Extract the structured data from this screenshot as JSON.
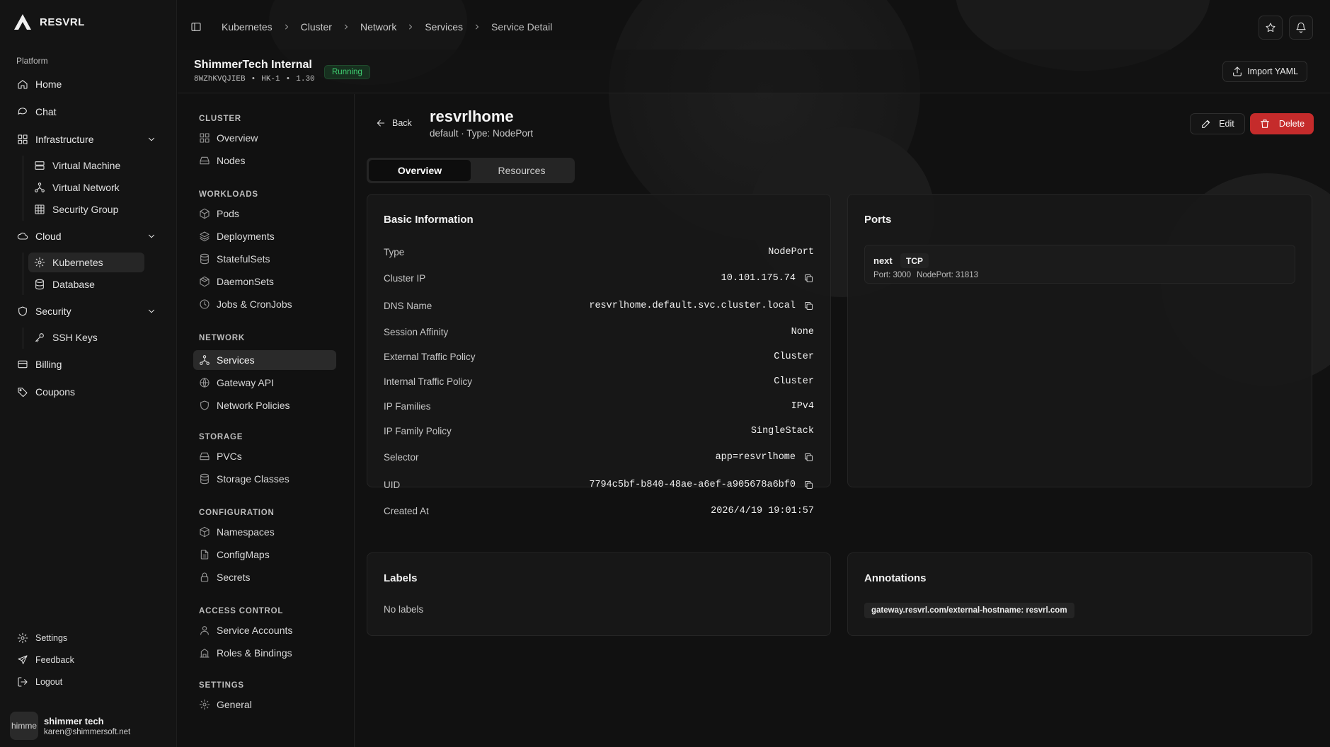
{
  "brand": {
    "name": "RESVRL"
  },
  "sidebar": {
    "group_label": "Platform",
    "items": [
      {
        "label": "Home",
        "icon": "home-icon"
      },
      {
        "label": "Chat",
        "icon": "chat-icon"
      },
      {
        "label": "Infrastructure",
        "icon": "grid-icon",
        "sub": [
          "Virtual Machine",
          "Virtual Network",
          "Security Group"
        ]
      },
      {
        "label": "Cloud",
        "icon": "cloud-icon",
        "sub": [
          "Kubernetes",
          "Database"
        ]
      },
      {
        "label": "Security",
        "icon": "shield-icon",
        "sub": [
          "SSH Keys"
        ]
      },
      {
        "label": "Billing",
        "icon": "card-icon"
      },
      {
        "label": "Coupons",
        "icon": "tag-icon"
      }
    ],
    "footer": [
      "Settings",
      "Feedback",
      "Logout"
    ],
    "user": {
      "avatar_text": "himme",
      "name": "shimmer tech",
      "email": "karen@shimmersoft.net"
    }
  },
  "breadcrumbs": [
    "Kubernetes",
    "Cluster",
    "Network",
    "Services",
    "Service Detail"
  ],
  "cluster": {
    "name": "ShimmerTech Internal",
    "id": "8WZhKVQJIEB",
    "region": "HK-1",
    "version": "1.30",
    "status": "Running",
    "dot": "•",
    "import_label": "Import YAML"
  },
  "subnav": {
    "sections": [
      {
        "title": "CLUSTER",
        "items": [
          "Overview",
          "Nodes"
        ]
      },
      {
        "title": "WORKLOADS",
        "items": [
          "Pods",
          "Deployments",
          "StatefulSets",
          "DaemonSets",
          "Jobs & CronJobs"
        ]
      },
      {
        "title": "NETWORK",
        "items": [
          "Services",
          "Gateway API",
          "Network Policies"
        ]
      },
      {
        "title": "STORAGE",
        "items": [
          "PVCs",
          "Storage Classes"
        ]
      },
      {
        "title": "CONFIGURATION",
        "items": [
          "Namespaces",
          "ConfigMaps",
          "Secrets"
        ]
      },
      {
        "title": "ACCESS CONTROL",
        "items": [
          "Service Accounts",
          "Roles & Bindings"
        ]
      },
      {
        "title": "SETTINGS",
        "items": [
          "General"
        ]
      }
    ]
  },
  "service": {
    "back_label": "Back",
    "name": "resvrlhome",
    "subtitle": "default · Type: NodePort",
    "edit_label": "Edit",
    "delete_label": "Delete",
    "tabs": [
      "Overview",
      "Resources"
    ]
  },
  "basic_info": {
    "title": "Basic Information",
    "rows": [
      {
        "key": "Type",
        "value": "NodePort"
      },
      {
        "key": "Cluster IP",
        "value": "10.101.175.74"
      },
      {
        "key": "DNS Name",
        "value": "resvrlhome.default.svc.cluster.local"
      },
      {
        "key": "Session Affinity",
        "value": "None"
      },
      {
        "key": "External Traffic Policy",
        "value": "Cluster"
      },
      {
        "key": "Internal Traffic Policy",
        "value": "Cluster"
      },
      {
        "key": "IP Families",
        "value": "IPv4"
      },
      {
        "key": "IP Family Policy",
        "value": "SingleStack"
      },
      {
        "key": "Selector",
        "value": "app=resvrlhome"
      },
      {
        "key": "UID",
        "value": "7794c5bf-b840-48ae-a6ef-a905678a6bf0"
      },
      {
        "key": "Created At",
        "value": "2026/4/19 19:01:57"
      }
    ]
  },
  "ports": {
    "title": "Ports",
    "items": [
      {
        "name": "next",
        "protocol": "TCP",
        "port": "Port: 3000",
        "node_port": "NodePort: 31813"
      }
    ]
  },
  "labels": {
    "title": "Labels",
    "empty": "No labels"
  },
  "annotations": {
    "title": "Annotations",
    "items": [
      "gateway.resvrl.com/external-hostname: resvrl.com"
    ]
  },
  "colors": {
    "accent_danger": "#c52b2b",
    "status_running": "#3fd071",
    "background": "#111111"
  }
}
